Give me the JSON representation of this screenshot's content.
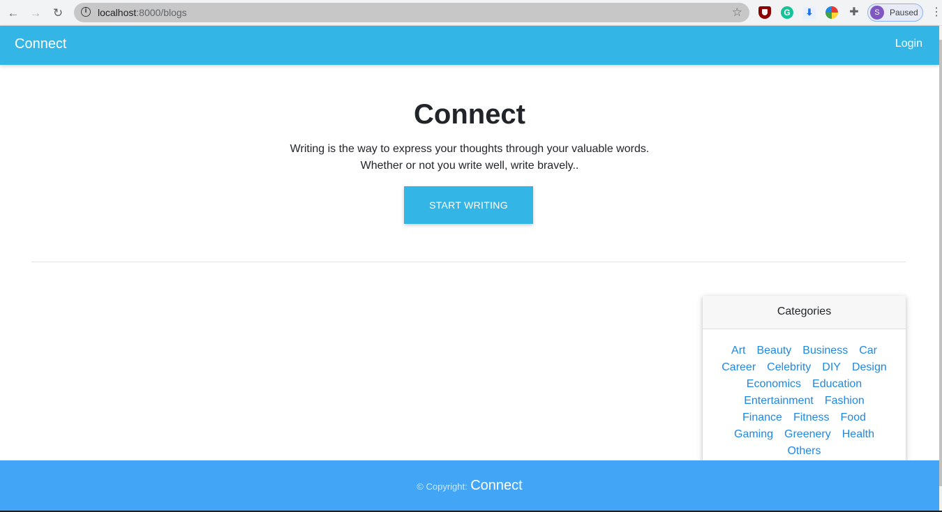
{
  "browser": {
    "url_host": "localhost",
    "url_path": ":8000/blogs",
    "profile_initial": "S",
    "profile_status": "Paused",
    "extension_g_label": "G",
    "extension_dl_label": "⬇"
  },
  "navbar": {
    "brand": "Connect",
    "login": "Login"
  },
  "hero": {
    "title": "Connect",
    "tagline_line1": "Writing is the way to express your thoughts through your valuable words.",
    "tagline_line2": "Whether or not you write well, write bravely..",
    "cta": "START WRITING"
  },
  "categories": {
    "header": "Categories",
    "items": [
      "Art",
      "Beauty",
      "Business",
      "Car",
      "Career",
      "Celebrity",
      "DIY",
      "Design",
      "Economics",
      "Education",
      "Entertainment",
      "Fashion",
      "Finance",
      "Fitness",
      "Food",
      "Gaming",
      "Greenery",
      "Health",
      "Others"
    ]
  },
  "footer": {
    "copyright": "© Copyright:",
    "brand": "Connect"
  },
  "colors": {
    "primary": "#33b5e5",
    "footer": "#42a5f5",
    "link": "#1e88e5"
  }
}
